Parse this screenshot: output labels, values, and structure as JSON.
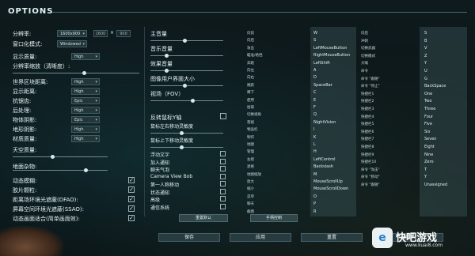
{
  "title": "OPTIONS",
  "left": {
    "resolution_label": "分辨率:",
    "resolution_value": "1600x900",
    "res_w": "1600",
    "res_x": "×",
    "res_h": "900",
    "window_mode_label": "窗口化模式:",
    "window_mode_value": "Windowed",
    "display_quality_label": "显示质量:",
    "display_quality_value": "High",
    "res_scale_label": "分辨率缩放（清晰度）:",
    "res_scale": 0.55,
    "settings": [
      {
        "label": "世界区块距离:",
        "value": "High"
      },
      {
        "label": "显示距离:",
        "value": "High"
      },
      {
        "label": "抗锯齿:",
        "value": "Epic"
      },
      {
        "label": "后处理:",
        "value": "High"
      },
      {
        "label": "物体阴影:",
        "value": "Epic"
      },
      {
        "label": "地形阴影:",
        "value": "High"
      },
      {
        "label": "材质质量:",
        "value": "High"
      }
    ],
    "sky_label": "天空质量:",
    "sky_level": 0.4,
    "grass_label": "地面杂物:",
    "grass_level": 0.75,
    "toggles": [
      {
        "label": "动态模糊:",
        "checked": true
      },
      {
        "label": "胶片颗粒:",
        "checked": true
      },
      {
        "label": "距离场环境光遮蔽(DFAO):",
        "checked": true
      },
      {
        "label": "屏幕空间环境光遮蔽(SSAO):",
        "checked": true
      },
      {
        "label": "动态画面适合(简单画面效):",
        "checked": true
      }
    ]
  },
  "middle": {
    "sliders": [
      {
        "label": "主音量",
        "level": 0.45
      },
      {
        "label": "音乐音量",
        "level": 0.2
      },
      {
        "label": "效果音量",
        "level": 0.2
      },
      {
        "label": "图像用户界面大小",
        "level": 0.45
      },
      {
        "label": "视场（FOV）",
        "level": 0.55
      }
    ],
    "invert_y_label": "反转鼠标Y轴",
    "sens_lr_label": "鼠标左右移动灵敏度",
    "sens_lr": 0.4,
    "sens_ud_label": "鼠标上下移动灵敏度",
    "sens_ud": 0.4,
    "checks": [
      {
        "label": "浮动文字",
        "checked": false
      },
      {
        "label": "加入通知",
        "checked": false
      },
      {
        "label": "聊天气泡",
        "checked": false
      },
      {
        "label": "Camera View Bob",
        "checked": false
      },
      {
        "label": "第一人称移动",
        "checked": false
      },
      {
        "label": "状态通知",
        "checked": false
      },
      {
        "label": "高级",
        "checked": false
      },
      {
        "label": "通信系统",
        "checked": false
      }
    ],
    "reset_default_label": "重置默认",
    "controller_label": "手柄控制"
  },
  "keys_left": [
    {
      "action": "向前",
      "key": "W"
    },
    {
      "action": "向后",
      "key": "S"
    },
    {
      "action": "攻击",
      "key": "LeftMouseButton"
    },
    {
      "action": "瞄准/格挡",
      "key": "RightMouseButton"
    },
    {
      "action": "奔跑",
      "key": "LeftShift"
    },
    {
      "action": "向左",
      "key": "A"
    },
    {
      "action": "向右",
      "key": "D"
    },
    {
      "action": "跳跃",
      "key": "SpaceBar"
    },
    {
      "action": "蹲下",
      "key": "C"
    },
    {
      "action": "使用",
      "key": "E"
    },
    {
      "action": "拾取",
      "key": "F"
    },
    {
      "action": "切换视角",
      "key": "Q"
    },
    {
      "action": "夜视",
      "key": "NightVision"
    },
    {
      "action": "物品栏",
      "key": "I"
    },
    {
      "action": "制作",
      "key": "K"
    },
    {
      "action": "地图",
      "key": "L"
    },
    {
      "action": "管理",
      "key": "H"
    },
    {
      "action": "左摇",
      "key": "LeftControl"
    },
    {
      "action": "退格",
      "key": "Backslash"
    },
    {
      "action": "地图缩放",
      "key": "M"
    },
    {
      "action": "放大",
      "key": "MouseScrollUp"
    },
    {
      "action": "缩小",
      "key": "MouseScrollDown"
    },
    {
      "action": "菜单",
      "key": "O"
    },
    {
      "action": "聊天",
      "key": "P"
    },
    {
      "action": "截图",
      "key": "R"
    }
  ],
  "keys_right": [
    {
      "action": "向后",
      "key": "S"
    },
    {
      "action": "冲刺",
      "key": "B"
    },
    {
      "action": "切换武器",
      "key": "V"
    },
    {
      "action": "切换模式",
      "key": "Z"
    },
    {
      "action": "大喊",
      "key": "Y"
    },
    {
      "action": "命令",
      "key": "U"
    },
    {
      "action": "命令 \"跟随\"",
      "key": "G"
    },
    {
      "action": "命令 \"停止\"",
      "key": "BackSpace"
    },
    {
      "action": "快捷栏1",
      "key": "One"
    },
    {
      "action": "快捷栏2",
      "key": "Two"
    },
    {
      "action": "快捷栏3",
      "key": "Three"
    },
    {
      "action": "快捷栏4",
      "key": "Four"
    },
    {
      "action": "快捷栏5",
      "key": "Five"
    },
    {
      "action": "快捷栏6",
      "key": "Six"
    },
    {
      "action": "快捷栏7",
      "key": "Seven"
    },
    {
      "action": "快捷栏8",
      "key": "Eight"
    },
    {
      "action": "快捷栏9",
      "key": "Nine"
    },
    {
      "action": "快捷栏10",
      "key": "Zero"
    },
    {
      "action": "命令 \"攻击\"",
      "key": "T"
    },
    {
      "action": "命令 \"移动\"",
      "key": "Y"
    },
    {
      "action": "命令 \"跟随\"",
      "key": "Unassigned"
    }
  ],
  "bottom": {
    "save": "保存",
    "apply": "应用",
    "reset": "重置",
    "back": "返回"
  },
  "watermark": {
    "logo": "e",
    "name": "快吧游戏",
    "url": "www.kuai8.com"
  }
}
